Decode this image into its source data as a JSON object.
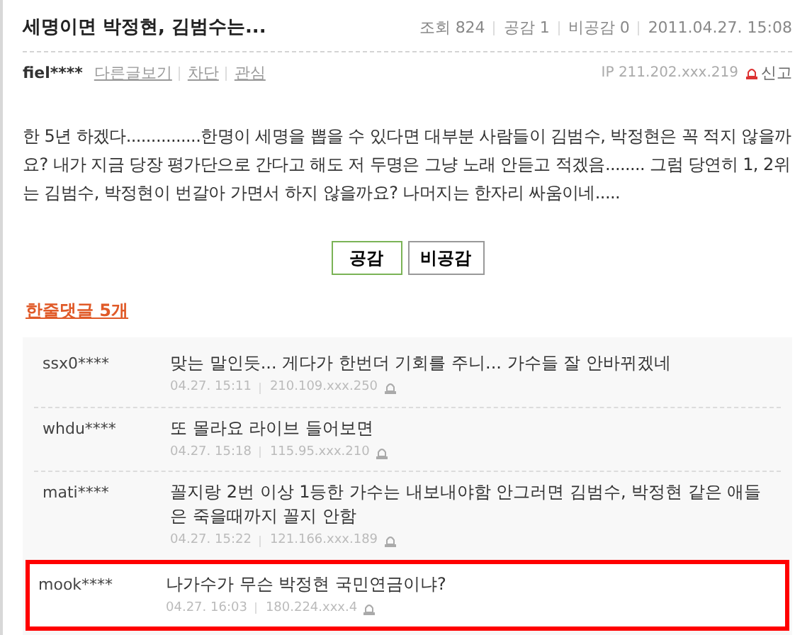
{
  "post": {
    "title": "세명이면 박정현, 김범수는...",
    "stats": [
      {
        "label": "조회",
        "value": "824"
      },
      {
        "label": "공감",
        "value": "1"
      },
      {
        "label": "비공감",
        "value": "0"
      }
    ],
    "date": "2011.04.27. 15:08",
    "author": "fiel****",
    "links": [
      "다른글보기",
      "차단",
      "관심"
    ],
    "ip": "IP 211.202.xxx.219",
    "report": "신고",
    "body": "한 5년 하겠다...............한명이 세명을 뽑을 수 있다면 대부분 사람들이 김범수, 박정현은 꼭 적지 않을까요? 내가 지금 당장 평가단으로 간다고 해도 저 두명은 그냥 노래 안듣고 적겠음........ 그럼 당연히 1, 2위는 김범수, 박정현이 번갈아 가면서 하지 않을까요? 나머지는 한자리 싸움이네.....",
    "buttons": [
      {
        "label": "공감",
        "selected": true
      },
      {
        "label": "비공감",
        "selected": false
      }
    ]
  },
  "comments_heading": "한줄댓글 5개",
  "comments": [
    {
      "author": "ssx0****",
      "text": "맞는 말인듯... 게다가 한번더 기회를 주니... 가수들 잘 안바뀌겠네",
      "time": "04.27. 15:11",
      "ip": "210.109.xxx.250",
      "highlighted": false
    },
    {
      "author": "whdu****",
      "text": "또 몰라요 라이브 들어보면",
      "time": "04.27. 15:18",
      "ip": "115.95.xxx.210",
      "highlighted": false
    },
    {
      "author": "mati****",
      "text": "꼴지랑 2번 이상 1등한 가수는 내보내야함 안그러면 김범수, 박정현 같은 애들은 죽을때까지 꼴지 안함",
      "time": "04.27. 15:22",
      "ip": "121.166.xxx.189",
      "highlighted": false
    },
    {
      "author": "mook****",
      "text": "나가수가 무슨 박정현 국민연금이냐?",
      "time": "04.27. 16:03",
      "ip": "180.224.xxx.4",
      "highlighted": true
    }
  ]
}
